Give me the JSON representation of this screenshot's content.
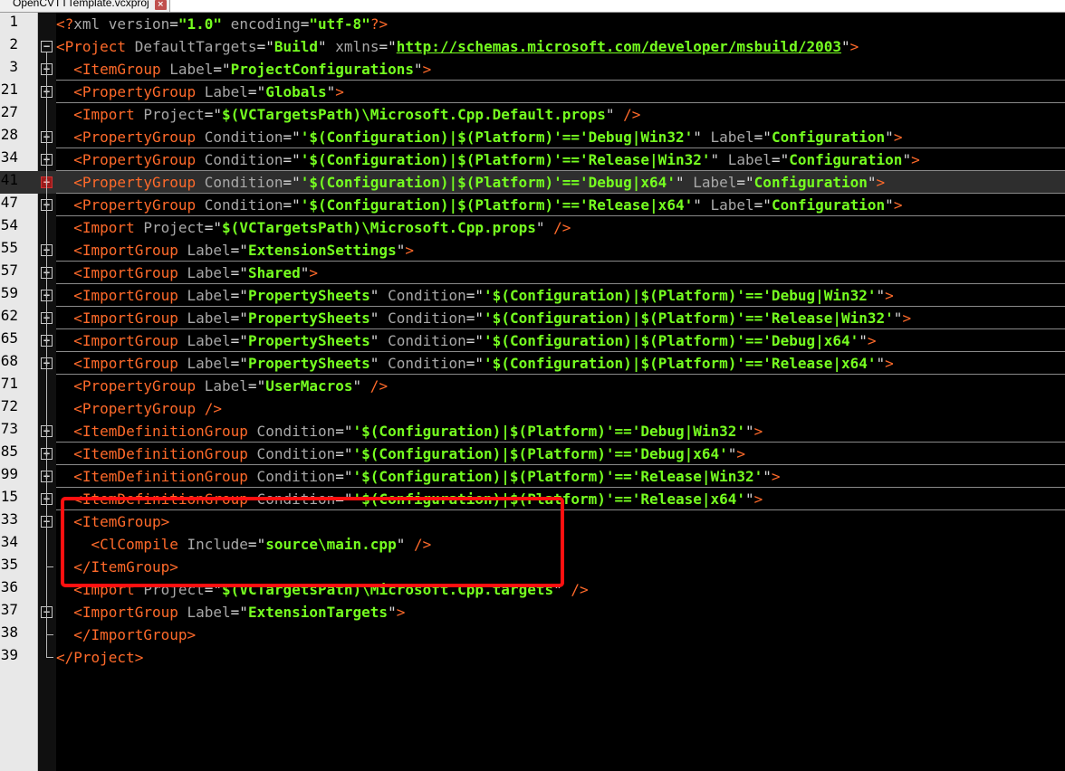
{
  "tab": {
    "filename": "OpenCVTTTemplate.vcxproj",
    "close_label": "×"
  },
  "colors": {
    "background": "#000000",
    "tag": "#ff6a2a",
    "attribute": "#a8a8a8",
    "string": "#76ff20",
    "equals": "#d8d8d8",
    "highlight_row": "#2e2e2e",
    "callout": "#ff1010"
  },
  "editor": {
    "lines": [
      {
        "num": "1",
        "fold": "none",
        "segs": [
          [
            "t",
            "<?"
          ],
          [
            "a",
            "xml version"
          ],
          [
            "e",
            "="
          ],
          [
            "s",
            "\"1.0\""
          ],
          [
            "a",
            " encoding"
          ],
          [
            "e",
            "="
          ],
          [
            "s",
            "\"utf-8\""
          ],
          [
            "t",
            "?>"
          ]
        ]
      },
      {
        "num": "2",
        "fold": "minus",
        "segs": [
          [
            "t",
            "<Project"
          ],
          [
            "a",
            " DefaultTargets"
          ],
          [
            "e",
            "="
          ],
          [
            "q",
            "\""
          ],
          [
            "s",
            "Build"
          ],
          [
            "q",
            "\""
          ],
          [
            "a",
            " xmlns"
          ],
          [
            "e",
            "="
          ],
          [
            "q",
            "\""
          ],
          [
            "u",
            "http://schemas.microsoft.com/developer/msbuild/2003"
          ],
          [
            "q",
            "\""
          ],
          [
            "t",
            ">"
          ]
        ]
      },
      {
        "num": "3",
        "fold": "plus",
        "segs": [
          [
            "e",
            "  "
          ],
          [
            "t",
            "<ItemGroup"
          ],
          [
            "a",
            " Label"
          ],
          [
            "e",
            "="
          ],
          [
            "q",
            "\""
          ],
          [
            "s",
            "ProjectConfigurations"
          ],
          [
            "q",
            "\""
          ],
          [
            "t",
            ">"
          ]
        ]
      },
      {
        "num": "21",
        "fold": "plus",
        "segs": [
          [
            "e",
            "  "
          ],
          [
            "t",
            "<PropertyGroup"
          ],
          [
            "a",
            " Label"
          ],
          [
            "e",
            "="
          ],
          [
            "q",
            "\""
          ],
          [
            "s",
            "Globals"
          ],
          [
            "q",
            "\""
          ],
          [
            "t",
            ">"
          ]
        ]
      },
      {
        "num": "27",
        "fold": "none",
        "segs": [
          [
            "e",
            "  "
          ],
          [
            "t",
            "<Import"
          ],
          [
            "a",
            " Project"
          ],
          [
            "e",
            "="
          ],
          [
            "q",
            "\""
          ],
          [
            "s",
            "$(VCTargetsPath)\\Microsoft.Cpp.Default.props"
          ],
          [
            "q",
            "\""
          ],
          [
            "t",
            " />"
          ]
        ]
      },
      {
        "num": "28",
        "fold": "plus",
        "segs": [
          [
            "e",
            "  "
          ],
          [
            "t",
            "<PropertyGroup"
          ],
          [
            "a",
            " Condition"
          ],
          [
            "e",
            "="
          ],
          [
            "q",
            "\""
          ],
          [
            "s",
            "'$(Configuration)|$(Platform)'=='Debug|Win32'"
          ],
          [
            "q",
            "\""
          ],
          [
            "a",
            " Label"
          ],
          [
            "e",
            "="
          ],
          [
            "q",
            "\""
          ],
          [
            "s",
            "Configuration"
          ],
          [
            "q",
            "\""
          ],
          [
            "t",
            ">"
          ]
        ]
      },
      {
        "num": "34",
        "fold": "plus",
        "segs": [
          [
            "e",
            "  "
          ],
          [
            "t",
            "<PropertyGroup"
          ],
          [
            "a",
            " Condition"
          ],
          [
            "e",
            "="
          ],
          [
            "q",
            "\""
          ],
          [
            "s",
            "'$(Configuration)|$(Platform)'=='Release|Win32'"
          ],
          [
            "q",
            "\""
          ],
          [
            "a",
            " Label"
          ],
          [
            "e",
            "="
          ],
          [
            "q",
            "\""
          ],
          [
            "s",
            "Configuration"
          ],
          [
            "q",
            "\""
          ],
          [
            "t",
            ">"
          ]
        ]
      },
      {
        "num": "41",
        "fold": "plus-active",
        "highlight": true,
        "segs": [
          [
            "e",
            "  "
          ],
          [
            "t",
            "<PropertyGroup"
          ],
          [
            "a",
            " Condition"
          ],
          [
            "e",
            "="
          ],
          [
            "q",
            "\""
          ],
          [
            "s",
            "'$(Configuration)|$(Platform)'=='Debug|x64'"
          ],
          [
            "q",
            "\""
          ],
          [
            "a",
            " Label"
          ],
          [
            "e",
            "="
          ],
          [
            "q",
            "\""
          ],
          [
            "s",
            "Configuration"
          ],
          [
            "q",
            "\""
          ],
          [
            "t",
            ">"
          ]
        ]
      },
      {
        "num": "47",
        "fold": "plus",
        "segs": [
          [
            "e",
            "  "
          ],
          [
            "t",
            "<PropertyGroup"
          ],
          [
            "a",
            " Condition"
          ],
          [
            "e",
            "="
          ],
          [
            "q",
            "\""
          ],
          [
            "s",
            "'$(Configuration)|$(Platform)'=='Release|x64'"
          ],
          [
            "q",
            "\""
          ],
          [
            "a",
            " Label"
          ],
          [
            "e",
            "="
          ],
          [
            "q",
            "\""
          ],
          [
            "s",
            "Configuration"
          ],
          [
            "q",
            "\""
          ],
          [
            "t",
            ">"
          ]
        ]
      },
      {
        "num": "54",
        "fold": "none",
        "segs": [
          [
            "e",
            "  "
          ],
          [
            "t",
            "<Import"
          ],
          [
            "a",
            " Project"
          ],
          [
            "e",
            "="
          ],
          [
            "q",
            "\""
          ],
          [
            "s",
            "$(VCTargetsPath)\\Microsoft.Cpp.props"
          ],
          [
            "q",
            "\""
          ],
          [
            "t",
            " />"
          ]
        ]
      },
      {
        "num": "55",
        "fold": "plus",
        "segs": [
          [
            "e",
            "  "
          ],
          [
            "t",
            "<ImportGroup"
          ],
          [
            "a",
            " Label"
          ],
          [
            "e",
            "="
          ],
          [
            "q",
            "\""
          ],
          [
            "s",
            "ExtensionSettings"
          ],
          [
            "q",
            "\""
          ],
          [
            "t",
            ">"
          ]
        ]
      },
      {
        "num": "57",
        "fold": "plus",
        "segs": [
          [
            "e",
            "  "
          ],
          [
            "t",
            "<ImportGroup"
          ],
          [
            "a",
            " Label"
          ],
          [
            "e",
            "="
          ],
          [
            "q",
            "\""
          ],
          [
            "s",
            "Shared"
          ],
          [
            "q",
            "\""
          ],
          [
            "t",
            ">"
          ]
        ]
      },
      {
        "num": "59",
        "fold": "plus",
        "segs": [
          [
            "e",
            "  "
          ],
          [
            "t",
            "<ImportGroup"
          ],
          [
            "a",
            " Label"
          ],
          [
            "e",
            "="
          ],
          [
            "q",
            "\""
          ],
          [
            "s",
            "PropertySheets"
          ],
          [
            "q",
            "\""
          ],
          [
            "a",
            " Condition"
          ],
          [
            "e",
            "="
          ],
          [
            "q",
            "\""
          ],
          [
            "s",
            "'$(Configuration)|$(Platform)'=='Debug|Win32'"
          ],
          [
            "q",
            "\""
          ],
          [
            "t",
            ">"
          ]
        ]
      },
      {
        "num": "62",
        "fold": "plus",
        "segs": [
          [
            "e",
            "  "
          ],
          [
            "t",
            "<ImportGroup"
          ],
          [
            "a",
            " Label"
          ],
          [
            "e",
            "="
          ],
          [
            "q",
            "\""
          ],
          [
            "s",
            "PropertySheets"
          ],
          [
            "q",
            "\""
          ],
          [
            "a",
            " Condition"
          ],
          [
            "e",
            "="
          ],
          [
            "q",
            "\""
          ],
          [
            "s",
            "'$(Configuration)|$(Platform)'=='Release|Win32'"
          ],
          [
            "q",
            "\""
          ],
          [
            "t",
            ">"
          ]
        ]
      },
      {
        "num": "65",
        "fold": "plus",
        "segs": [
          [
            "e",
            "  "
          ],
          [
            "t",
            "<ImportGroup"
          ],
          [
            "a",
            " Label"
          ],
          [
            "e",
            "="
          ],
          [
            "q",
            "\""
          ],
          [
            "s",
            "PropertySheets"
          ],
          [
            "q",
            "\""
          ],
          [
            "a",
            " Condition"
          ],
          [
            "e",
            "="
          ],
          [
            "q",
            "\""
          ],
          [
            "s",
            "'$(Configuration)|$(Platform)'=='Debug|x64'"
          ],
          [
            "q",
            "\""
          ],
          [
            "t",
            ">"
          ]
        ]
      },
      {
        "num": "68",
        "fold": "plus",
        "segs": [
          [
            "e",
            "  "
          ],
          [
            "t",
            "<ImportGroup"
          ],
          [
            "a",
            " Label"
          ],
          [
            "e",
            "="
          ],
          [
            "q",
            "\""
          ],
          [
            "s",
            "PropertySheets"
          ],
          [
            "q",
            "\""
          ],
          [
            "a",
            " Condition"
          ],
          [
            "e",
            "="
          ],
          [
            "q",
            "\""
          ],
          [
            "s",
            "'$(Configuration)|$(Platform)'=='Release|x64'"
          ],
          [
            "q",
            "\""
          ],
          [
            "t",
            ">"
          ]
        ]
      },
      {
        "num": "71",
        "fold": "none",
        "segs": [
          [
            "e",
            "  "
          ],
          [
            "t",
            "<PropertyGroup"
          ],
          [
            "a",
            " Label"
          ],
          [
            "e",
            "="
          ],
          [
            "q",
            "\""
          ],
          [
            "s",
            "UserMacros"
          ],
          [
            "q",
            "\""
          ],
          [
            "t",
            " />"
          ]
        ]
      },
      {
        "num": "72",
        "fold": "none",
        "segs": [
          [
            "e",
            "  "
          ],
          [
            "t",
            "<PropertyGroup />"
          ]
        ]
      },
      {
        "num": "73",
        "fold": "plus",
        "segs": [
          [
            "e",
            "  "
          ],
          [
            "t",
            "<ItemDefinitionGroup"
          ],
          [
            "a",
            " Condition"
          ],
          [
            "e",
            "="
          ],
          [
            "q",
            "\""
          ],
          [
            "s",
            "'$(Configuration)|$(Platform)'=='Debug|Win32'"
          ],
          [
            "q",
            "\""
          ],
          [
            "t",
            ">"
          ]
        ]
      },
      {
        "num": "85",
        "fold": "plus",
        "segs": [
          [
            "e",
            "  "
          ],
          [
            "t",
            "<ItemDefinitionGroup"
          ],
          [
            "a",
            " Condition"
          ],
          [
            "e",
            "="
          ],
          [
            "q",
            "\""
          ],
          [
            "s",
            "'$(Configuration)|$(Platform)'=='Debug|x64'"
          ],
          [
            "q",
            "\""
          ],
          [
            "t",
            ">"
          ]
        ]
      },
      {
        "num": "99",
        "fold": "plus",
        "segs": [
          [
            "e",
            "  "
          ],
          [
            "t",
            "<ItemDefinitionGroup"
          ],
          [
            "a",
            " Condition"
          ],
          [
            "e",
            "="
          ],
          [
            "q",
            "\""
          ],
          [
            "s",
            "'$(Configuration)|$(Platform)'=='Release|Win32'"
          ],
          [
            "q",
            "\""
          ],
          [
            "t",
            ">"
          ]
        ]
      },
      {
        "num": "15",
        "fold": "plus",
        "segs": [
          [
            "e",
            "  "
          ],
          [
            "t",
            "<ItemDefinitionGroup"
          ],
          [
            "a",
            " Condition"
          ],
          [
            "e",
            "="
          ],
          [
            "q",
            "\""
          ],
          [
            "s",
            "'$(Configuration)|$(Platform)'=='Release|x64'"
          ],
          [
            "q",
            "\""
          ],
          [
            "t",
            ">"
          ]
        ]
      },
      {
        "num": "33",
        "fold": "minus",
        "segs": [
          [
            "e",
            "  "
          ],
          [
            "t",
            "<ItemGroup>"
          ]
        ]
      },
      {
        "num": "34",
        "fold": "none",
        "segs": [
          [
            "e",
            "    "
          ],
          [
            "t",
            "<ClCompile"
          ],
          [
            "a",
            " Include"
          ],
          [
            "e",
            "="
          ],
          [
            "q",
            "\""
          ],
          [
            "s",
            "source\\main.cpp"
          ],
          [
            "q",
            "\""
          ],
          [
            "t",
            " />"
          ]
        ]
      },
      {
        "num": "35",
        "fold": "none",
        "segs": [
          [
            "e",
            "  "
          ],
          [
            "t",
            "</ItemGroup>"
          ]
        ]
      },
      {
        "num": "36",
        "fold": "none",
        "segs": [
          [
            "e",
            "  "
          ],
          [
            "t",
            "<Import"
          ],
          [
            "a",
            " Project"
          ],
          [
            "e",
            "="
          ],
          [
            "q",
            "\""
          ],
          [
            "s",
            "$(VCTargetsPath)\\Microsoft.Cpp.targets"
          ],
          [
            "q",
            "\""
          ],
          [
            "t",
            " />"
          ]
        ]
      },
      {
        "num": "37",
        "fold": "minus",
        "segs": [
          [
            "e",
            "  "
          ],
          [
            "t",
            "<ImportGroup"
          ],
          [
            "a",
            " Label"
          ],
          [
            "e",
            "="
          ],
          [
            "q",
            "\""
          ],
          [
            "s",
            "ExtensionTargets"
          ],
          [
            "q",
            "\""
          ],
          [
            "t",
            ">"
          ]
        ]
      },
      {
        "num": "38",
        "fold": "none",
        "segs": [
          [
            "e",
            "  "
          ],
          [
            "t",
            "</ImportGroup>"
          ]
        ]
      },
      {
        "num": "39",
        "fold": "none",
        "segs": [
          [
            "t",
            "</Project>"
          ]
        ]
      }
    ]
  }
}
